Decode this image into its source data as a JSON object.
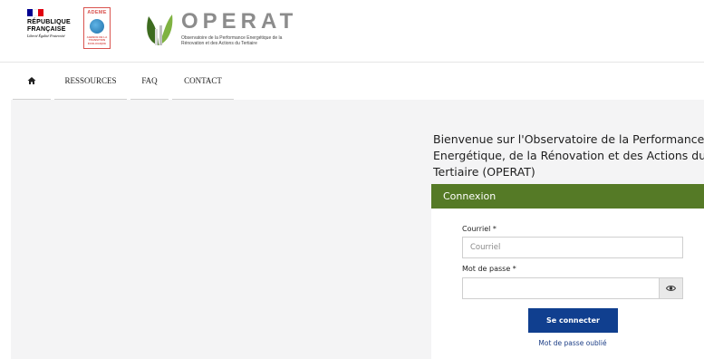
{
  "header": {
    "republique": {
      "title": "RÉPUBLIQUE FRANÇAISE",
      "motto": "Liberté Égalité Fraternité",
      "flag_colors": [
        "#000091",
        "#ffffff",
        "#e1000f"
      ]
    },
    "ademe": {
      "name": "ADEME",
      "subtitle": "AGENCE DE LA TRANSITION ÉCOLOGIQUE"
    },
    "operat": {
      "title": "OPERAT",
      "subtitle": "Observatoire de la Performance Energétique de la Rénovation et des Actions du Tertiaire"
    }
  },
  "nav": {
    "home_icon": "home-icon",
    "items": [
      {
        "label": "RESSOURCES"
      },
      {
        "label": "FAQ"
      },
      {
        "label": "CONTACT"
      }
    ]
  },
  "main": {
    "welcome": [
      "Bienvenue sur l'Observatoire de la Performance",
      "Energétique, de la Rénovation et des Actions du",
      "Tertiaire (OPERAT)"
    ],
    "login": {
      "header": "Connexion",
      "email_label": "Courriel *",
      "email_placeholder": "Courriel",
      "email_value": "",
      "password_label": "Mot de passe *",
      "password_placeholder": "",
      "password_value": "",
      "show_password_icon": "eye-icon",
      "submit_label": "Se connecter",
      "forgot_label": "Mot de passe oublié"
    }
  },
  "colors": {
    "connexion_header": "#557a26",
    "submit_button": "#103f8f",
    "link": "#1c3e86",
    "background": "#f4f4f5"
  }
}
